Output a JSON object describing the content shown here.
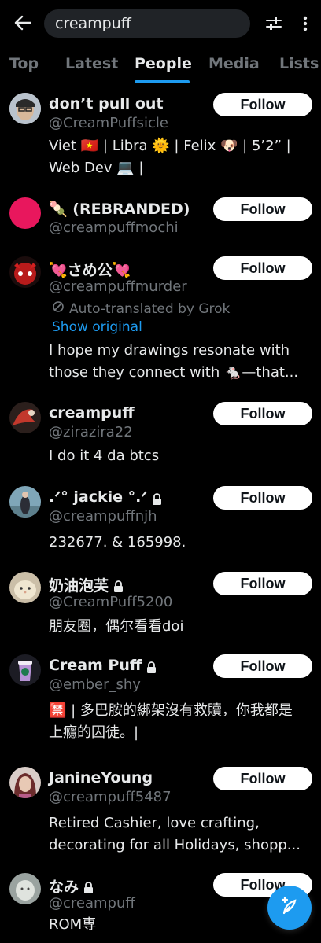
{
  "search": {
    "query": "creampuff"
  },
  "tabs": [
    {
      "label": "Top",
      "active": false
    },
    {
      "label": "Latest",
      "active": false
    },
    {
      "label": "People",
      "active": true
    },
    {
      "label": "Media",
      "active": false
    },
    {
      "label": "Lists",
      "active": false
    }
  ],
  "colors": {
    "accent": "#1d9bf0",
    "muted": "#71767b",
    "text": "#e7e9ea",
    "background": "#000000"
  },
  "icons": {
    "back": "arrow-left-icon",
    "filter": "sliders-icon",
    "more": "more-vertical-icon",
    "lock": "lock-icon",
    "translate": "grok-icon",
    "compose": "feather-plus-icon"
  },
  "follow_label": "Follow",
  "people": [
    {
      "name": "don’t pull out",
      "handle": "@CreamPuffsicle",
      "locked": false,
      "bio": [
        "Viet 🇻🇳 | Libra 🌞 | Felix 🐶 | 5’2” |",
        "Web Dev 💻 |"
      ]
    },
    {
      "name": "🍡 (REBRANDED)",
      "handle": "@creampuffmochi",
      "locked": false,
      "bio": []
    },
    {
      "name": "💘さめ公💘",
      "handle": "@creampuffmurder",
      "locked": false,
      "translated_label": "Auto-translated by Grok",
      "show_original": "Show original",
      "bio": [
        "I hope my drawings resonate with",
        "those they connect with 🐁—that..."
      ]
    },
    {
      "name": "creampuff",
      "handle": "@zirazira22",
      "locked": false,
      "bio": [
        "I do it 4 da btcs"
      ]
    },
    {
      "name": ".ᐟ° jackie °.ᐟ",
      "handle": "@creampuffnjh",
      "locked": true,
      "bio": [
        "232677. & 165998."
      ]
    },
    {
      "name": "奶油泡芙",
      "handle": "@CreamPuff5200",
      "locked": true,
      "bio": [
        "朋友圈，偶尔看看doi"
      ]
    },
    {
      "name": "Cream Puff",
      "handle": "@ember_shy",
      "locked": true,
      "bio": [
        "🈲 | 多巴胺的綁架沒有救贖，你我都是",
        "上癮的囚徒。|"
      ]
    },
    {
      "name": "JanineYoung",
      "handle": "@creampuff5487",
      "locked": false,
      "bio": [
        "Retired Cashier, love crafting,",
        "decorating for all Holidays, shopp..."
      ]
    },
    {
      "name": "なみ",
      "handle": "@creampuff",
      "locked": true,
      "bio": [
        "ROM専"
      ]
    }
  ]
}
